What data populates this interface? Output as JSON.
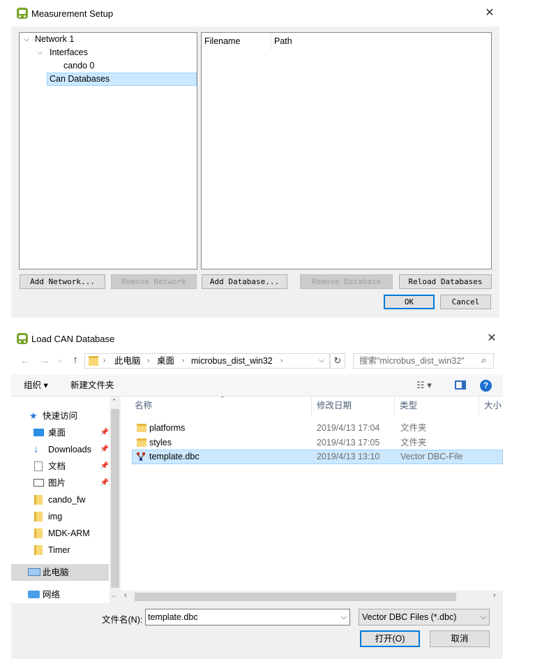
{
  "setup_dialog": {
    "title": "Measurement Setup",
    "close": "✕",
    "tree": [
      {
        "label": "Network 1",
        "expanded": true
      },
      {
        "label": "Interfaces",
        "expanded": true
      },
      {
        "label": "cando 0"
      },
      {
        "label": "Can Databases",
        "selected": true
      }
    ],
    "columns": [
      "Filename",
      "Path"
    ],
    "buttons": {
      "add_network": "Add Network...",
      "remove_network": "Remove Network",
      "add_database": "Add Database...",
      "remove_database": "Remove Database",
      "reload_databases": "Reload Databases",
      "ok": "OK",
      "cancel": "Cancel"
    }
  },
  "load_dialog": {
    "title": "Load CAN Database",
    "close": "✕",
    "breadcrumb": [
      "此电脑",
      "桌面",
      "microbus_dist_win32"
    ],
    "search_placeholder": "搜索\"microbus_dist_win32\"",
    "toolbar": {
      "organize": "组织 ▾",
      "new_folder": "新建文件夹"
    },
    "nav": {
      "quick_access": "快速访问",
      "items": [
        "桌面",
        "Downloads",
        "文档",
        "图片",
        "cando_fw",
        "img",
        "MDK-ARM",
        "Timer"
      ],
      "this_pc": "此电脑",
      "network": "网络"
    },
    "columns": {
      "name": "名称",
      "date": "修改日期",
      "type": "类型",
      "size": "大小"
    },
    "files": [
      {
        "name": "platforms",
        "date": "2019/4/13 17:04",
        "type": "文件夹",
        "kind": "folder"
      },
      {
        "name": "styles",
        "date": "2019/4/13 17:05",
        "type": "文件夹",
        "kind": "folder"
      },
      {
        "name": "template.dbc",
        "date": "2019/4/13 13:10",
        "type": "Vector DBC-File",
        "kind": "dbc",
        "selected": true
      }
    ],
    "filename_label": "文件名(N):",
    "filename_value": "template.dbc",
    "filter": "Vector DBC Files (*.dbc)",
    "open": "打开(O)",
    "cancel": "取消"
  },
  "colors": {
    "accent": "#0078d7",
    "selection": "#cce8ff",
    "app_icon": "#7ba52d"
  }
}
